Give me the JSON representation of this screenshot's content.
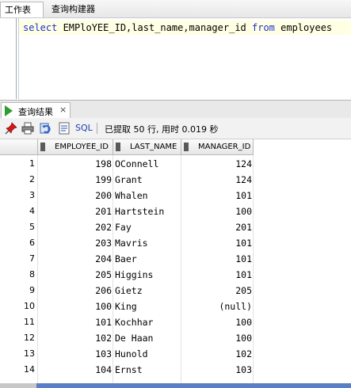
{
  "editor_tabs": [
    "工作表",
    "查询构建器"
  ],
  "editor": {
    "code_parts": [
      {
        "t": "select",
        "kw": true
      },
      {
        "t": " EMPloYEE_ID,last_name,manager_id ",
        "kw": false
      },
      {
        "t": "from",
        "kw": true
      },
      {
        "t": " employees",
        "kw": false
      }
    ]
  },
  "results_tab": {
    "label": "查询结果",
    "close": "×"
  },
  "toolbar": {
    "sql_label": "SQL",
    "status": "已提取 50 行, 用时 0.019 秒"
  },
  "grid": {
    "columns": [
      "EMPLOYEE_ID",
      "LAST_NAME",
      "MANAGER_ID"
    ],
    "rows": [
      {
        "n": "1",
        "id": "198",
        "name": "OConnell",
        "mgr": "124"
      },
      {
        "n": "2",
        "id": "199",
        "name": "Grant",
        "mgr": "124"
      },
      {
        "n": "3",
        "id": "200",
        "name": "Whalen",
        "mgr": "101"
      },
      {
        "n": "4",
        "id": "201",
        "name": "Hartstein",
        "mgr": "100"
      },
      {
        "n": "5",
        "id": "202",
        "name": "Fay",
        "mgr": "201"
      },
      {
        "n": "6",
        "id": "203",
        "name": "Mavris",
        "mgr": "101"
      },
      {
        "n": "7",
        "id": "204",
        "name": "Baer",
        "mgr": "101"
      },
      {
        "n": "8",
        "id": "205",
        "name": "Higgins",
        "mgr": "101"
      },
      {
        "n": "9",
        "id": "206",
        "name": "Gietz",
        "mgr": "205"
      },
      {
        "n": "10",
        "id": "100",
        "name": "King",
        "mgr": "(null)"
      },
      {
        "n": "11",
        "id": "101",
        "name": "Kochhar",
        "mgr": "100"
      },
      {
        "n": "12",
        "id": "102",
        "name": "De Haan",
        "mgr": "100"
      },
      {
        "n": "13",
        "id": "103",
        "name": "Hunold",
        "mgr": "102"
      },
      {
        "n": "14",
        "id": "104",
        "name": "Ernst",
        "mgr": "103"
      }
    ]
  }
}
